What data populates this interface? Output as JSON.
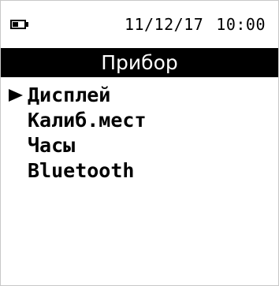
{
  "status_bar": {
    "battery_icon": "battery-icon",
    "battery_level": 0.5,
    "date": "11/12/17",
    "time": "10:00"
  },
  "title": "Прибор",
  "menu": {
    "cursor_icon": "triangle-right-icon",
    "selected_index": 0,
    "items": [
      {
        "label": "Дисплей"
      },
      {
        "label": "Калиб.мест"
      },
      {
        "label": "Часы"
      },
      {
        "label": "Bluetooth"
      }
    ]
  },
  "colors": {
    "background": "#ffffff",
    "title_bar": "#000000",
    "title_text": "#ffffff"
  }
}
